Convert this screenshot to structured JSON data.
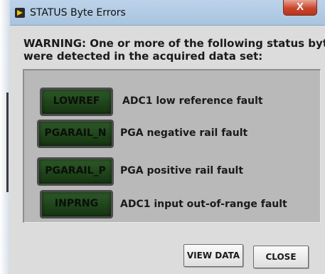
{
  "window": {
    "title": "STATUS Byte Errors",
    "close_glyph": "X"
  },
  "warning": {
    "line1": "WARNING: One or more of the following status byte fa",
    "line2": "were detected in the acquired data set:"
  },
  "flags": [
    {
      "indicator": "LOWREF",
      "label": "ADC1 low reference fault"
    },
    {
      "indicator": "PGARAIL_N",
      "label": "PGA negative rail fault"
    },
    {
      "indicator": "PGARAIL_P",
      "label": "PGA positive rail fault"
    },
    {
      "indicator": "INPRNG",
      "label": "ADC1 input out-of-range fault"
    }
  ],
  "buttons": {
    "view_data": "VIEW DATA",
    "close": "CLOSE"
  },
  "colors": {
    "indicator_on": "#1e4219",
    "panel": "#b9b9b9",
    "close_button": "#c9452b"
  },
  "icons": {
    "app": "labview-icon",
    "close": "close-icon"
  }
}
